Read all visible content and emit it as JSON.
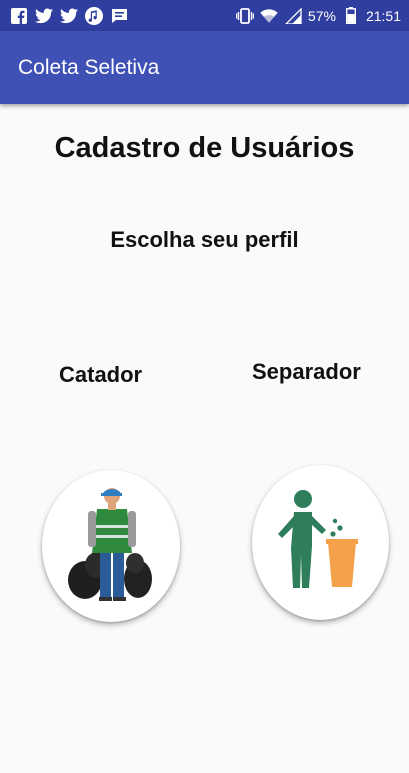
{
  "status_bar": {
    "icons_left": [
      "facebook-icon",
      "twitter-icon",
      "twitter-icon",
      "music-icon",
      "message-icon"
    ],
    "battery_percent": "57%",
    "time": "21:51",
    "icons_right": [
      "vibrate-icon",
      "wifi-icon",
      "signal-icon",
      "battery-icon"
    ]
  },
  "app_bar": {
    "title": "Coleta Seletiva"
  },
  "main": {
    "title": "Cadastro de Usuários",
    "subtitle": "Escolha seu perfil",
    "profiles": [
      {
        "label": "Catador",
        "icon": "waste-picker-icon"
      },
      {
        "label": "Separador",
        "icon": "person-recycling-icon"
      }
    ]
  },
  "colors": {
    "primary": "#3f51b5",
    "primary_dark": "#303f9f",
    "background": "#fafafa",
    "accent_green": "#2e7d5b",
    "accent_orange": "#f5a04a"
  }
}
